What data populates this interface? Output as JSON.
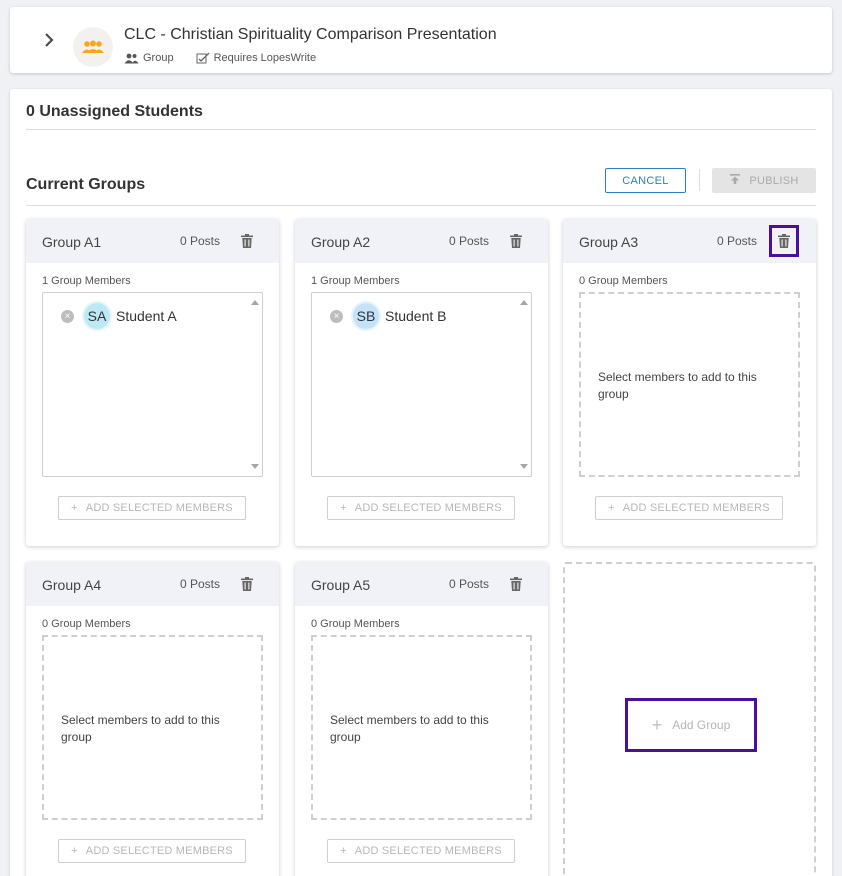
{
  "header": {
    "title": "CLC - Christian Spirituality Comparison Presentation",
    "type_label": "Group",
    "requirement_label": "Requires LopesWrite",
    "icons": {
      "expand": "chevron-right-icon",
      "logo": "group-people-icon",
      "type": "users-icon",
      "requirement": "document-check-icon"
    },
    "accent_color": "#f5a623"
  },
  "unassigned": {
    "label": "0 Unassigned Students"
  },
  "groups_section": {
    "title": "Current Groups",
    "cancel_label": "CANCEL",
    "publish_label": "PUBLISH",
    "cancel_color": "#2d7fc1",
    "highlight_color": "#4b0f9c"
  },
  "groups": [
    {
      "name": "Group A1",
      "posts": "0 Posts",
      "members_count": "1 Group Members",
      "members": [
        {
          "initials": "SA",
          "name": "Student A"
        }
      ],
      "empty_text": "",
      "add_label": "ADD SELECTED MEMBERS"
    },
    {
      "name": "Group A2",
      "posts": "0 Posts",
      "members_count": "1 Group Members",
      "members": [
        {
          "initials": "SB",
          "name": "Student B"
        }
      ],
      "empty_text": "",
      "add_label": "ADD SELECTED MEMBERS"
    },
    {
      "name": "Group A3",
      "posts": "0 Posts",
      "members_count": "0 Group Members",
      "members": [],
      "empty_text": "Select members to add to this group",
      "add_label": "ADD SELECTED MEMBERS"
    },
    {
      "name": "Group A4",
      "posts": "0 Posts",
      "members_count": "0 Group Members",
      "members": [],
      "empty_text": "Select members to add to this group",
      "add_label": "ADD SELECTED MEMBERS"
    },
    {
      "name": "Group A5",
      "posts": "0 Posts",
      "members_count": "0 Group Members",
      "members": [],
      "empty_text": "Select members to add to this group",
      "add_label": "ADD SELECTED MEMBERS"
    }
  ],
  "add_group": {
    "label": "Add Group"
  }
}
